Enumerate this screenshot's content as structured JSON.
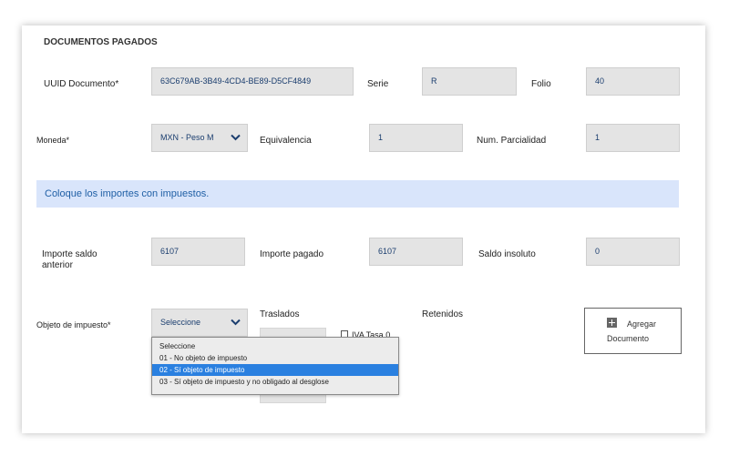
{
  "section": {
    "title": "DOCUMENTOS PAGADOS"
  },
  "uuid": {
    "label": "UUID Documento*",
    "value": "63C679AB-3B49-4CD4-BE89-D5CF4849"
  },
  "serie": {
    "label": "Serie",
    "value": "R"
  },
  "folio": {
    "label": "Folio",
    "value": "40"
  },
  "moneda": {
    "label": "Moneda*",
    "value": "MXN - Peso M"
  },
  "equivalencia": {
    "label": "Equivalencia",
    "value": "1"
  },
  "parcialidad": {
    "label": "Num. Parcialidad",
    "value": "1"
  },
  "info": {
    "text": "Coloque los importes con impuestos."
  },
  "saldo_anterior": {
    "label_line1": "Importe saldo",
    "label_line2": "anterior",
    "value": "6107"
  },
  "importe_pagado": {
    "label": "Importe pagado",
    "value": "6107"
  },
  "saldo_insoluto": {
    "label": "Saldo insoluto",
    "value": "0"
  },
  "objeto": {
    "label": "Objeto de impuesto*",
    "value": "Seleccione",
    "options": [
      "Seleccione",
      "01 - No objeto de impuesto",
      "02 - Sí objeto de impuesto",
      "03 - Sí objeto de impuesto y no obligado al desglose"
    ],
    "highlighted_index": 2
  },
  "traslados": {
    "label": "Traslados",
    "iva_label": "IVA Tasa 0"
  },
  "retenidos": {
    "label": "Retenidos"
  },
  "add_document": {
    "line1": "Agregar",
    "line2": "Documento",
    "icon": "plus-square-icon"
  },
  "colors": {
    "accent": "#2a80e0",
    "info_bg": "#d9e5fb",
    "info_text": "#1f5fa5",
    "field_bg": "#e4e4e4",
    "field_text": "#1a3d6e"
  }
}
